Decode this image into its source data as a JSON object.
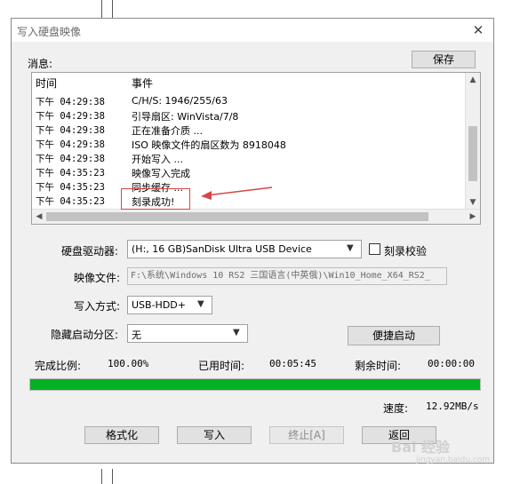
{
  "window": {
    "title": "写入硬盘映像",
    "close_glyph": "✕"
  },
  "messages": {
    "label": "消息:",
    "save_button": "保存",
    "columns": {
      "time": "时间",
      "event": "事件"
    },
    "rows": [
      {
        "time": "下午 04:29:38",
        "event": "C/H/S: 1946/255/63"
      },
      {
        "time": "下午 04:29:38",
        "event": "引导扇区: WinVista/7/8"
      },
      {
        "time": "下午 04:29:38",
        "event": "正在准备介质 ..."
      },
      {
        "time": "下午 04:29:38",
        "event": "ISO 映像文件的扇区数为 8918048"
      },
      {
        "time": "下午 04:29:38",
        "event": "开始写入 ..."
      },
      {
        "time": "下午 04:35:23",
        "event": "映像写入完成"
      },
      {
        "time": "下午 04:35:23",
        "event": "同步缓存 ..."
      },
      {
        "time": "下午 04:35:23",
        "event": "刻录成功!"
      }
    ]
  },
  "form": {
    "drive_label": "硬盘驱动器:",
    "drive_value": "(H:, 16 GB)SanDisk Ultra USB Device",
    "verify_label": "刻录校验",
    "verify_checked": false,
    "image_label": "映像文件:",
    "image_value": "F:\\系统\\Windows 10 RS2 三国语言(中英俄)\\Win10_Home_X64_RS2_",
    "write_mode_label": "写入方式:",
    "write_mode_value": "USB-HDD+",
    "hidden_partition_label": "隐藏启动分区:",
    "hidden_partition_value": "无",
    "quick_boot_button": "便捷启动"
  },
  "status": {
    "completion_label": "完成比例:",
    "completion_value": "100.00%",
    "progress_fraction": 1.0,
    "elapsed_label": "已用时间:",
    "elapsed_value": "00:05:45",
    "remaining_label": "剩余时间:",
    "remaining_value": "00:00:00",
    "speed_label": "速度:",
    "speed_value": "12.92MB/s"
  },
  "buttons": {
    "format": "格式化",
    "write": "写入",
    "abort": "终止[A]",
    "back": "返回"
  },
  "watermark": {
    "text": "Bai 经验",
    "sub": "jingyan.baidu.com"
  },
  "colors": {
    "progress": "#06b025",
    "annotation": "#d84545"
  }
}
